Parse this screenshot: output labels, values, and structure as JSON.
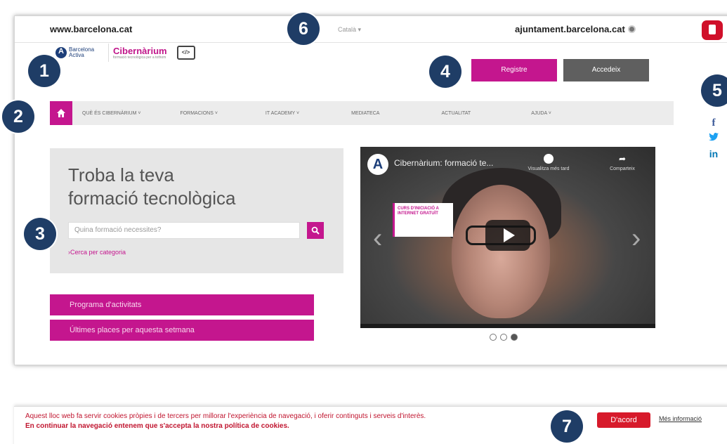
{
  "topbar": {
    "site_url": "www.barcelona.cat",
    "language": "Català ▾",
    "ajuntament": "ajuntament.barcelona.cat"
  },
  "logo": {
    "barcelona_activa": "Barcelona Activa",
    "cibernarium": "Cibernàrium",
    "cibernarium_sub": "formació tecnològica per a tothom",
    "code_icon": "</>"
  },
  "auth": {
    "register_label": "Registre",
    "login_label": "Accedeix"
  },
  "nav": {
    "home_icon": "home-icon",
    "items": [
      {
        "label": "QUÈ ÉS CIBERNÀRIUM ˅"
      },
      {
        "label": "FORMACIONS ˅"
      },
      {
        "label": "IT ACADEMY ˅"
      },
      {
        "label": "MEDIATECA"
      },
      {
        "label": "ACTUALITAT"
      },
      {
        "label": "AJUDA ˅"
      }
    ]
  },
  "search": {
    "title_line1": "Troba la teva",
    "title_line2": "formació tecnològica",
    "placeholder": "Quina formació necessites?",
    "category_link": "›Cerca per categoria"
  },
  "actions": {
    "program_label": "Programa d'activitats",
    "last_places_label": "Últimes places per aquesta setmana"
  },
  "video": {
    "logo_letter": "A",
    "title": "Cibernàrium: formació te...",
    "watch_later": "Visualitza més tard",
    "share": "Comparteix",
    "card_text": "CURS D'INICIACIÓ A INTERNET GRATUÏT"
  },
  "carousel": {
    "count": 3,
    "active_index": 2
  },
  "social": {
    "facebook": "f",
    "twitter": "🐦",
    "linkedin": "in"
  },
  "cookie": {
    "line1": "Aquest lloc web fa servir cookies pròpies i de tercers per millorar l'experiència de navegació, i oferir continguts i serveis d'interès.",
    "line2": "En continuar la navegació entenem que s'accepta la nostra política de cookies.",
    "accept_label": "D'acord",
    "more_info": "Més informació"
  },
  "markers": [
    "1",
    "2",
    "3",
    "4",
    "5",
    "6",
    "7"
  ],
  "colors": {
    "accent": "#c4168e",
    "dark_button": "#5f5f5f",
    "marker": "#1f3d66",
    "cookie_red": "#d71a2b"
  }
}
